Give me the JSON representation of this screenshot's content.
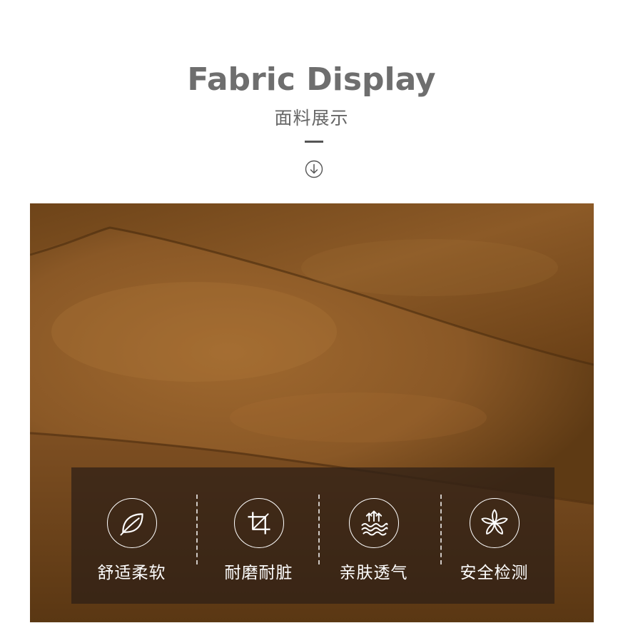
{
  "header": {
    "title": "Fabric Display",
    "subtitle": "面料展示"
  },
  "icons": {
    "down": "arrow-down-circle-icon"
  },
  "photo": {
    "subject": "brown-puffer-fabric-image"
  },
  "features": [
    {
      "label": "舒适柔软",
      "icon": "leaf-icon"
    },
    {
      "label": "耐磨耐脏",
      "icon": "crop-icon"
    },
    {
      "label": "亲肤透气",
      "icon": "breathable-waves-icon"
    },
    {
      "label": "安全检测",
      "icon": "flower-icon"
    }
  ],
  "colors": {
    "fabric": "#8a5a2a",
    "title": "#6e6e6e",
    "panel": "#2d1e16"
  }
}
